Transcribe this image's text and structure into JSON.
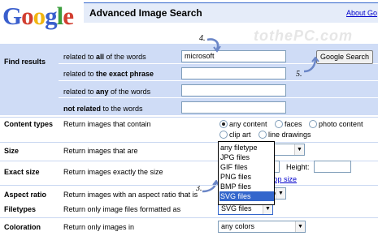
{
  "brand": {
    "logo_letters": [
      "G",
      "o",
      "o",
      "g",
      "l",
      "e"
    ],
    "logo_colors": [
      "#3a5fcd",
      "#d23f31",
      "#f1b511",
      "#3a5fcd",
      "#3c9e3d",
      "#d23f31"
    ]
  },
  "header": {
    "title": "Advanced Image Search",
    "about_link": "About Go",
    "watermark": "tothePC.com"
  },
  "find_results": {
    "section_label": "Find results",
    "rows": [
      {
        "prefix": "related to ",
        "bold": "all",
        "suffix": " of the words",
        "value": "microsoft"
      },
      {
        "prefix": "related to ",
        "bold": "the exact phrase",
        "suffix": "",
        "value": ""
      },
      {
        "prefix": "related to ",
        "bold": "any",
        "suffix": " of the words",
        "value": ""
      },
      {
        "prefix": "",
        "bold": "not related",
        "suffix": " to the words",
        "value": ""
      }
    ],
    "search_button": "Google Search"
  },
  "steps": {
    "step4": "4.",
    "step5": "5.",
    "step3": "3."
  },
  "content_types": {
    "label": "Content types",
    "description": "Return images that contain",
    "options": [
      "any content",
      "faces",
      "photo content",
      "clip art",
      "line drawings"
    ],
    "selected": "any content"
  },
  "size": {
    "label": "Size",
    "description": "Return images that are"
  },
  "exact_size": {
    "label": "Exact size",
    "description": "Return images exactly the size",
    "height_label": "Height:",
    "link_partial": "top size"
  },
  "aspect_ratio": {
    "label": "Aspect ratio",
    "description": "Return images with an aspect ratio that is",
    "value_partial": "o"
  },
  "filetypes": {
    "label": "Filetypes",
    "description": "Return only image files formatted as",
    "selected": "SVG files",
    "options": [
      "any filetype",
      "JPG files",
      "GIF files",
      "PNG files",
      "BMP files",
      "SVG files"
    ],
    "highlighted": "SVG files"
  },
  "coloration": {
    "label": "Coloration",
    "description": "Return only images in",
    "selected": "any colors"
  },
  "colors": {
    "panel": "#cfdcf6",
    "topbar": "#e5ecf9",
    "highlight": "#3366cc",
    "link": "#0000cc"
  }
}
